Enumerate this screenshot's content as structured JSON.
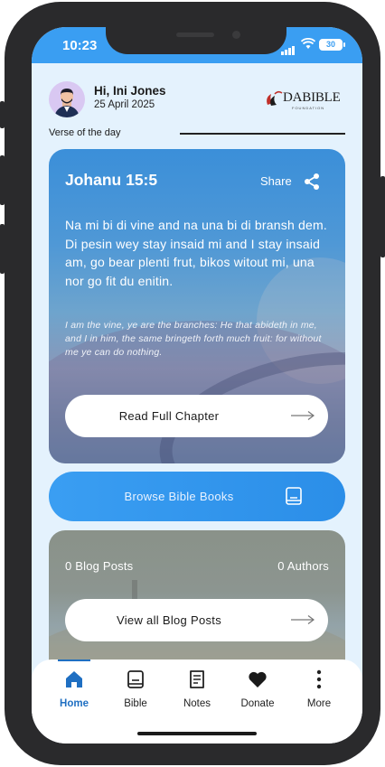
{
  "status": {
    "time": "10:23",
    "battery": "30"
  },
  "header": {
    "greeting": "Hi, Ini Jones",
    "date": "25 April 2025",
    "logo_text": "DABIBLE",
    "logo_subtext": "FOUNDATION"
  },
  "verse_section": {
    "title": "Verse of the day"
  },
  "verse_card": {
    "reference": "Johanu 15:5",
    "share_label": "Share",
    "pidgin_text": "Na mi bi di vine and na una bi di bransh dem. Di pesin wey stay insaid mi and I stay insaid am, go bear plenti frut, bikos witout mi, una nor go fit du enitin.",
    "english_text": "I am the vine, ye are the branches: He that abideth in me, and I in him, the same bringeth forth much fruit: for without me ye can do nothing.",
    "read_button": "Read Full Chapter"
  },
  "browse_button": {
    "label": "Browse Bible Books"
  },
  "blog": {
    "posts_count": "0 Blog Posts",
    "authors_count": "0 Authors",
    "button": "View all Blog Posts"
  },
  "tabs": [
    {
      "label": "Home",
      "icon": "home-icon",
      "active": true
    },
    {
      "label": "Bible",
      "icon": "bible-icon",
      "active": false
    },
    {
      "label": "Notes",
      "icon": "notes-icon",
      "active": false
    },
    {
      "label": "Donate",
      "icon": "heart-icon",
      "active": false
    },
    {
      "label": "More",
      "icon": "more-vertical-icon",
      "active": false
    }
  ],
  "colors": {
    "accent": "#3a9ef2",
    "active_tab": "#1f6fc2",
    "background": "#e4f2fd"
  }
}
